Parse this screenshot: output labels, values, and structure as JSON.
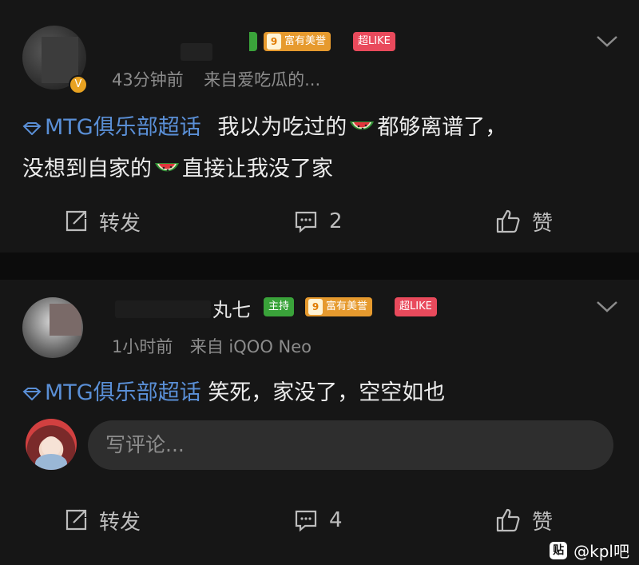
{
  "post1": {
    "badges": {
      "fame_level": "9",
      "fame_label": "富有美誉",
      "like_label": "超LIKE",
      "verified": "V"
    },
    "time": "43分钟前",
    "source": "来自爱吃瓜的...",
    "topic": "MTG俱乐部超话",
    "text_a": "我以为吃过的",
    "text_b": "都够离谱了，",
    "text_c": "没想到自家的",
    "text_d": "直接让我没了家",
    "repost_label": "转发",
    "comment_count": "2",
    "like_label": "赞"
  },
  "post2": {
    "name_tail": "丸七",
    "badges": {
      "host_label": "主持",
      "fame_level": "9",
      "fame_label": "富有美誉",
      "like_label": "超LIKE"
    },
    "time": "1小时前",
    "source": "来自 iQOO Neo",
    "topic": "MTG俱乐部超话",
    "text": "笑死，家没了，空空如也",
    "comment_placeholder": "写评论...",
    "repost_label": "转发",
    "comment_count": "4",
    "like_label": "赞"
  },
  "watermark": {
    "logo": "贴",
    "text": "@kpl吧"
  },
  "colors": {
    "topic": "#5a8fd6",
    "host_badge": "#3aa33a",
    "fame_badge": "#e69a2e",
    "like_badge": "#e94a5c",
    "background": "#161616"
  }
}
